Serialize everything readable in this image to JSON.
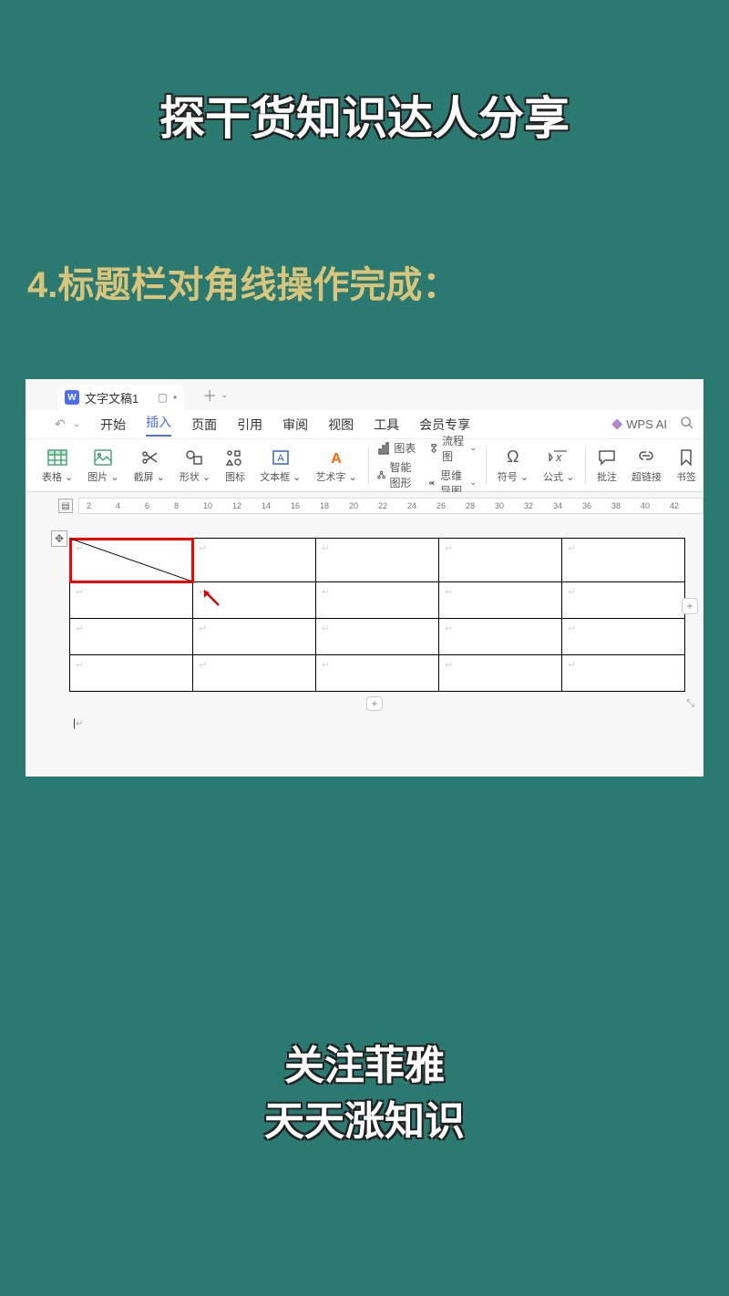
{
  "title": "探干货知识达人分享",
  "subtitle": "4.标题栏对角线操作完成：",
  "tab": {
    "name": "文字文稿1"
  },
  "menu": {
    "items": [
      "开始",
      "插入",
      "页面",
      "引用",
      "审阅",
      "视图",
      "工具",
      "会员专享"
    ],
    "active_index": 1,
    "ai_label": "WPS AI"
  },
  "ribbon": [
    {
      "label": "表格",
      "icon": "grid",
      "dropdown": true
    },
    {
      "label": "图片",
      "icon": "image",
      "dropdown": true
    },
    {
      "label": "截屏",
      "icon": "scissors",
      "dropdown": true
    },
    {
      "label": "形状",
      "icon": "shapes",
      "dropdown": true
    },
    {
      "label": "图标",
      "icon": "icons"
    },
    {
      "label": "文本框",
      "icon": "textbox",
      "dropdown": true
    },
    {
      "label": "艺术字",
      "icon": "wordart",
      "dropdown": true
    },
    {
      "label": "图表",
      "icon": "chart",
      "prefix": true
    },
    {
      "label": "流程图",
      "icon": "flowchart",
      "dropdown": true,
      "prefix": true
    },
    {
      "label": "智能图形",
      "icon": "smartart",
      "prefix": true
    },
    {
      "label": "思维导图",
      "icon": "mindmap",
      "dropdown": true,
      "prefix": true
    },
    {
      "label": "符号",
      "icon": "omega",
      "dropdown": true
    },
    {
      "label": "公式",
      "icon": "formula",
      "dropdown": true
    },
    {
      "label": "批注",
      "icon": "comment"
    },
    {
      "label": "超链接",
      "icon": "link"
    },
    {
      "label": "书签",
      "icon": "bookmark"
    }
  ],
  "ruler_ticks": [
    2,
    4,
    6,
    8,
    10,
    12,
    14,
    16,
    18,
    20,
    22,
    24,
    26,
    28,
    30,
    32,
    34,
    36,
    38,
    40,
    42
  ],
  "table": {
    "rows": 4,
    "cols": 5,
    "highlight": [
      0,
      0
    ]
  },
  "footer": {
    "line1": "关注菲雅",
    "line2": "天天涨知识"
  }
}
